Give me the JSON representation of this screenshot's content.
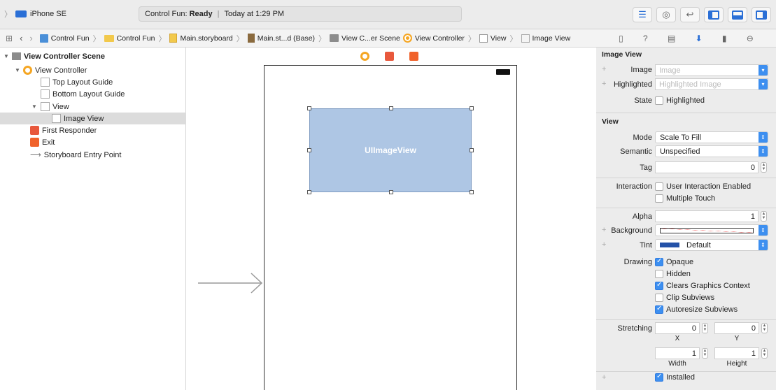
{
  "toolbar": {
    "scheme_device": "iPhone SE",
    "status_app": "Control Fun:",
    "status_state": "Ready",
    "status_time": "Today at 1:29 PM"
  },
  "jumpbar": {
    "items": [
      "Control Fun",
      "Control Fun",
      "Main.storyboard",
      "Main.st...d (Base)",
      "View C...er Scene",
      "View Controller",
      "View",
      "Image View"
    ]
  },
  "outline": {
    "rows": [
      {
        "label": "View Controller Scene",
        "bold": true
      },
      {
        "label": "View Controller"
      },
      {
        "label": "Top Layout Guide"
      },
      {
        "label": "Bottom Layout Guide"
      },
      {
        "label": "View"
      },
      {
        "label": "Image View"
      },
      {
        "label": "First Responder"
      },
      {
        "label": "Exit"
      },
      {
        "label": "Storyboard Entry Point"
      }
    ]
  },
  "canvas": {
    "image_view_label": "UIImageView"
  },
  "inspector": {
    "image_view_section": "Image View",
    "image_label": "Image",
    "image_placeholder": "Image",
    "highlighted_label": "Highlighted",
    "highlighted_placeholder": "Highlighted Image",
    "state_label": "State",
    "state_highlighted": "Highlighted",
    "view_section": "View",
    "mode_label": "Mode",
    "mode_value": "Scale To Fill",
    "semantic_label": "Semantic",
    "semantic_value": "Unspecified",
    "tag_label": "Tag",
    "tag_value": "0",
    "interaction_label": "Interaction",
    "user_interaction": "User Interaction Enabled",
    "multiple_touch": "Multiple Touch",
    "alpha_label": "Alpha",
    "alpha_value": "1",
    "background_label": "Background",
    "tint_label": "Tint",
    "tint_value": "Default",
    "drawing_label": "Drawing",
    "opaque": "Opaque",
    "hidden": "Hidden",
    "clears_graphics": "Clears Graphics Context",
    "clip_subviews": "Clip Subviews",
    "autoresize_subviews": "Autoresize Subviews",
    "stretching_label": "Stretching",
    "stretch_x": "0",
    "stretch_y": "0",
    "stretch_w": "1",
    "stretch_h": "1",
    "x_label": "X",
    "y_label": "Y",
    "width_label": "Width",
    "height_label": "Height",
    "installed": "Installed"
  }
}
